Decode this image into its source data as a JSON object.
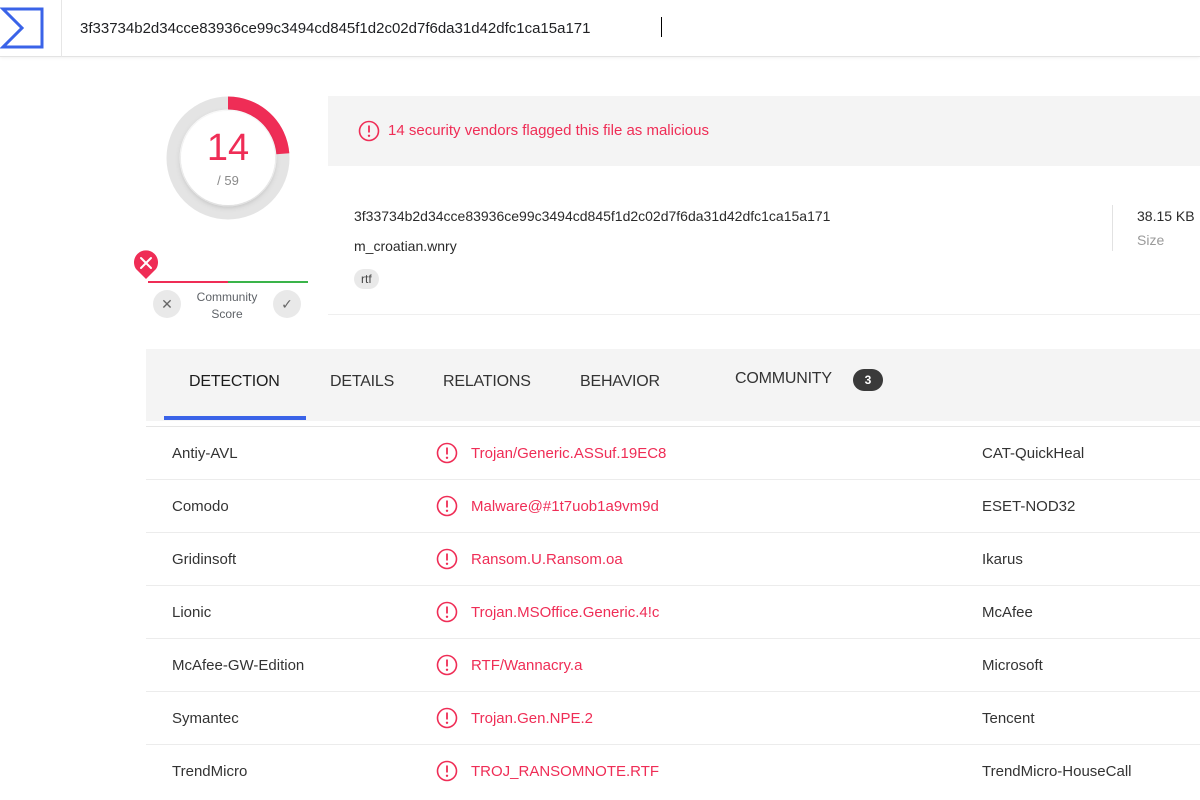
{
  "search": {
    "value": "3f33734b2d34cce83936ce99c3494cd845f1d2c02d7f6da31d42dfc1ca15a171"
  },
  "score": {
    "detections": "14",
    "total": "/ 59",
    "fraction": 0.2373
  },
  "community": {
    "label_line1": "Community",
    "label_line2": "Score",
    "no_icon": "x-icon",
    "yes_icon": "check-icon"
  },
  "alert": {
    "text": "14 security vendors flagged this file as malicious"
  },
  "file": {
    "hash": "3f33734b2d34cce83936ce99c3494cd845f1d2c02d7f6da31d42dfc1ca15a171",
    "name": "m_croatian.wnry",
    "tag": "rtf",
    "size_value": "38.15 KB",
    "size_label": "Size"
  },
  "tabs": {
    "detection": "DETECTION",
    "details": "DETAILS",
    "relations": "RELATIONS",
    "behavior": "BEHAVIOR",
    "community": "COMMUNITY",
    "community_count": "3"
  },
  "detections": [
    {
      "vendor": "Antiy-AVL",
      "result": "Trojan/Generic.ASSuf.19EC8",
      "vendor2": "CAT-QuickHeal"
    },
    {
      "vendor": "Comodo",
      "result": "Malware@#1t7uob1a9vm9d",
      "vendor2": "ESET-NOD32"
    },
    {
      "vendor": "Gridinsoft",
      "result": "Ransom.U.Ransom.oa",
      "vendor2": "Ikarus"
    },
    {
      "vendor": "Lionic",
      "result": "Trojan.MSOffice.Generic.4!c",
      "vendor2": "McAfee"
    },
    {
      "vendor": "McAfee-GW-Edition",
      "result": "RTF/Wannacry.a",
      "vendor2": "Microsoft"
    },
    {
      "vendor": "Symantec",
      "result": "Trojan.Gen.NPE.2",
      "vendor2": "Tencent"
    },
    {
      "vendor": "TrendMicro",
      "result": "TROJ_RANSOMNOTE.RTF",
      "vendor2": "TrendMicro-HouseCall"
    }
  ],
  "colors": {
    "malicious": "#ef2d56",
    "harmless": "#3ab44a",
    "accent": "#3a63e8",
    "logo": "#3a63e8"
  }
}
